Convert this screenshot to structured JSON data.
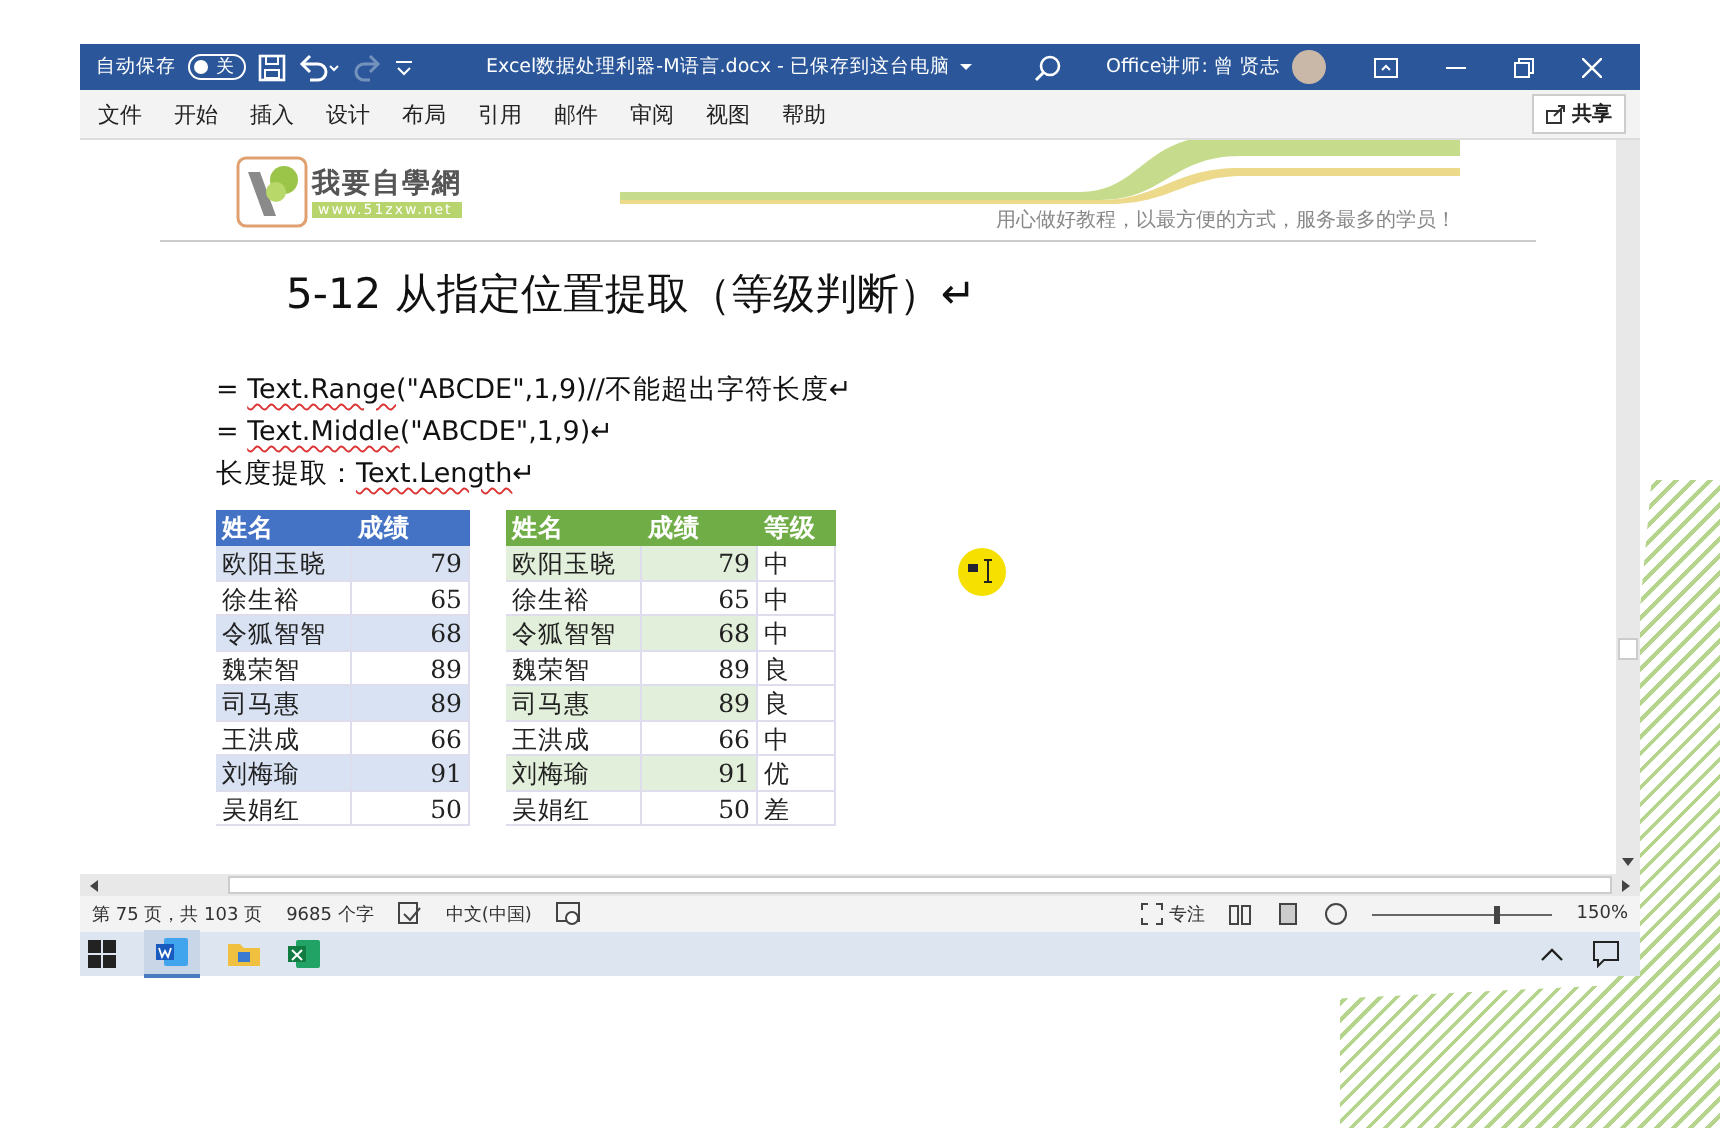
{
  "title_bar": {
    "autosave_label": "自动保存",
    "autosave_toggle": {
      "label": "关",
      "on": false
    },
    "redo_disabled": true,
    "title": "Excel数据处理利器-M语言.docx  -  已保存到这台电脑",
    "user": "Office讲师: 曾 贤志"
  },
  "ribbon_tabs": [
    {
      "label": "文件",
      "selected": false
    },
    {
      "label": "开始",
      "selected": false
    },
    {
      "label": "插入",
      "selected": false
    },
    {
      "label": "设计",
      "selected": false
    },
    {
      "label": "布局",
      "selected": false
    },
    {
      "label": "引用",
      "selected": false
    },
    {
      "label": "邮件",
      "selected": false
    },
    {
      "label": "审阅",
      "selected": false
    },
    {
      "label": "视图",
      "selected": false
    },
    {
      "label": "帮助",
      "selected": false
    }
  ],
  "share_button": "共享",
  "document": {
    "header": {
      "logo_text": "我要自學網",
      "logo_url": "www.51zxw.net",
      "slogan": "用心做好教程，以最方便的方式，服务最多的学员！"
    },
    "heading": "5-12 从指定位置提取（等级判断）↵",
    "lines": [
      [
        {
          "text": "= ",
          "flagged": false
        },
        {
          "text": "Text.Range",
          "flagged": true
        },
        {
          "text": "(\"ABCDE\",1,9)//不能超出字符长度↵",
          "flagged": false
        }
      ],
      [
        {
          "text": "= ",
          "flagged": false
        },
        {
          "text": "Text.Middle",
          "flagged": true
        },
        {
          "text": "(\"ABCDE\",1,9)↵",
          "flagged": false
        }
      ],
      [
        {
          "text": "长度提取：",
          "flagged": false
        },
        {
          "text": "Text.Length",
          "flagged": true
        },
        {
          "text": "↵",
          "flagged": false
        }
      ]
    ],
    "tables": [
      {
        "columns": [
          "姓名",
          "成绩"
        ],
        "rows": [
          [
            "欧阳玉晓",
            "79"
          ],
          [
            "徐生裕",
            "65"
          ],
          [
            "令狐智智",
            "68"
          ],
          [
            "魏荣智",
            "89"
          ],
          [
            "司马惠",
            "89"
          ],
          [
            "王洪成",
            "66"
          ],
          [
            "刘梅瑜",
            "91"
          ],
          [
            "吴娟红",
            "50"
          ]
        ]
      },
      {
        "columns": [
          "姓名",
          "成绩",
          "等级"
        ],
        "rows": [
          [
            "欧阳玉晓",
            "79",
            "中"
          ],
          [
            "徐生裕",
            "65",
            "中"
          ],
          [
            "令狐智智",
            "68",
            "中"
          ],
          [
            "魏荣智",
            "89",
            "良"
          ],
          [
            "司马惠",
            "89",
            "良"
          ],
          [
            "王洪成",
            "66",
            "中"
          ],
          [
            "刘梅瑜",
            "91",
            "优"
          ],
          [
            "吴娟红",
            "50",
            "差"
          ]
        ]
      }
    ]
  },
  "status_bar": {
    "page": "第 75 页，共 103 页",
    "words": "9685 个字",
    "language": "中文(中国)",
    "focus": "专注",
    "zoom_slider": {
      "level": 0.67
    },
    "zoom": "150%"
  }
}
